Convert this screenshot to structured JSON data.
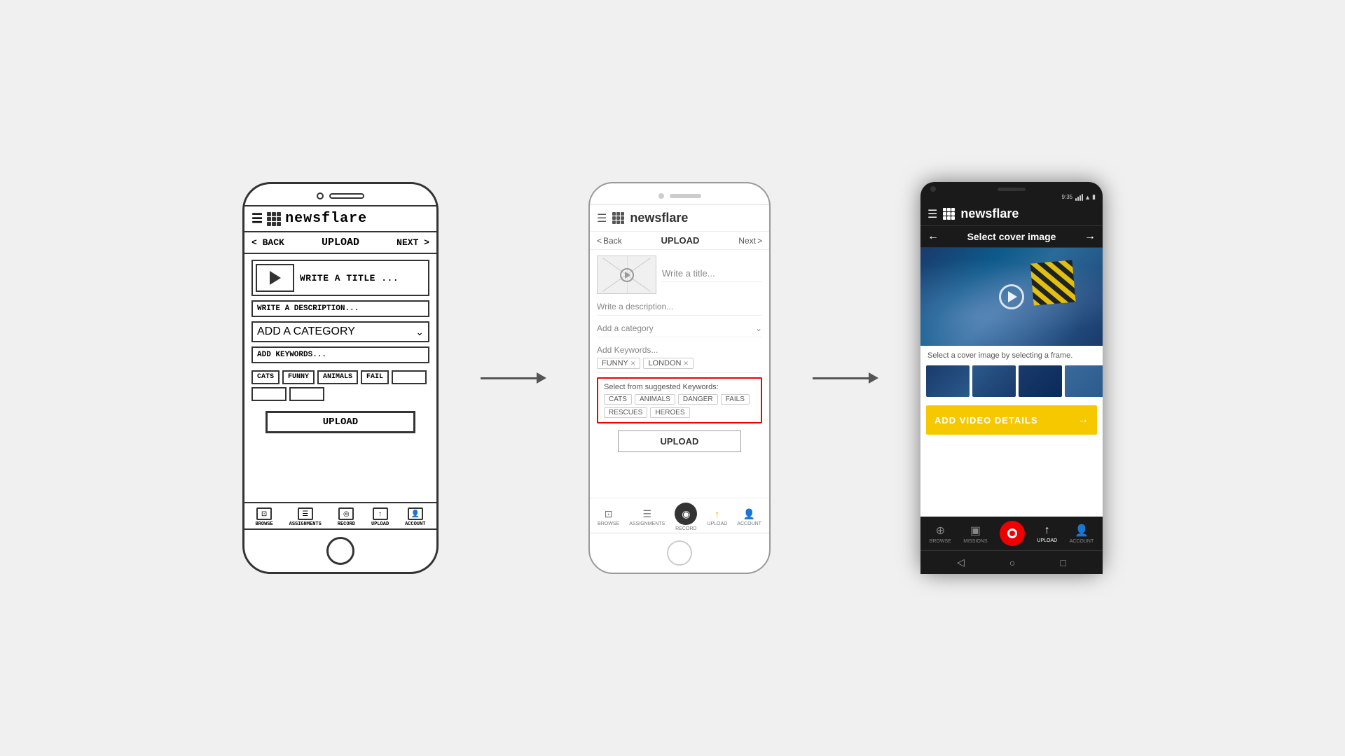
{
  "app": {
    "brand": "newsflare",
    "logo_alt": "newsflare logo"
  },
  "phone1": {
    "nav": {
      "back": "< BACK",
      "upload": "UPLOAD",
      "next": "NEXT >"
    },
    "fields": {
      "title": "WRITE A TITLE ...",
      "description": "WRITE A DESCRIPTION...",
      "category": "ADD A CATEGORY",
      "keywords": "ADD KEYWORDS..."
    },
    "keyword_tags": [
      "CATS",
      "FUNNY",
      "ANIMALS",
      "FAIL"
    ],
    "upload_btn": "UPLOAD",
    "bottom_nav": [
      "BROWSE",
      "ASSIGNMENTS",
      "RECORD",
      "UPLOAD",
      "ACCOUNT"
    ]
  },
  "phone2": {
    "nav": {
      "back": "Back",
      "upload": "UPLOAD",
      "next": "Next"
    },
    "fields": {
      "title": "Write a title...",
      "description": "Write a description...",
      "category": "Add a category",
      "keywords": "Add Keywords..."
    },
    "active_tags": [
      "FUNNY",
      "LONDON"
    ],
    "suggested_label": "Select from suggested Keywords:",
    "suggested_tags": [
      "CATS",
      "ANIMALS",
      "DANGER",
      "FAILS",
      "RESCUES",
      "HEROES"
    ],
    "upload_btn": "UPLOAD",
    "bottom_nav": [
      "BROWSE",
      "ASSIGNMENTS",
      "RECORD",
      "UPLOAD",
      "ACCOUNT"
    ]
  },
  "phone3": {
    "status_time": "9:35",
    "nav": {
      "title": "Select cover image"
    },
    "image_desc": "Select a cover image by selecting a frame.",
    "add_btn": "ADD VIDEO DETAILS",
    "bottom_nav": [
      "BROWSE",
      "MISSIONS",
      "RECORD",
      "UPLOAD",
      "ACCOUNT"
    ],
    "system_nav": [
      "◁",
      "○",
      "□"
    ]
  }
}
